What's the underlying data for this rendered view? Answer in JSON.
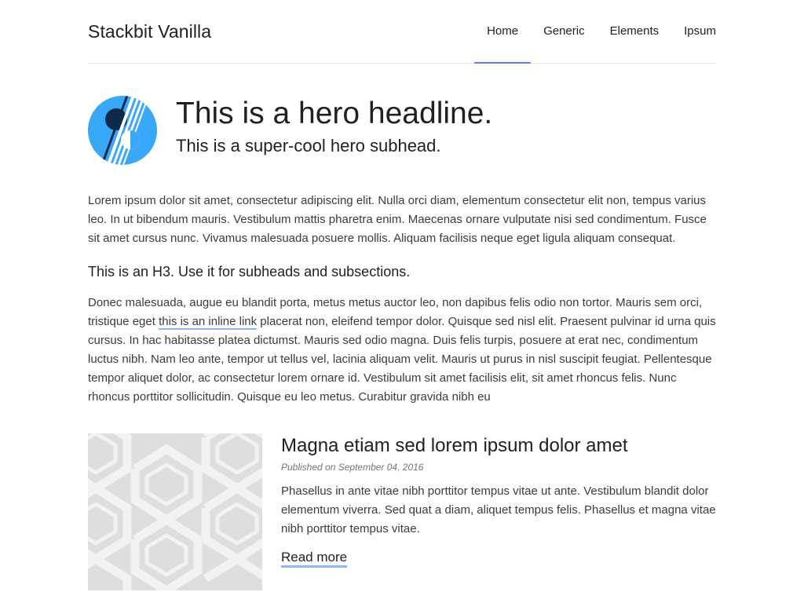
{
  "site": {
    "title": "Stackbit Vanilla"
  },
  "nav": {
    "items": [
      {
        "label": "Home",
        "active": true
      },
      {
        "label": "Generic",
        "active": false
      },
      {
        "label": "Elements",
        "active": false
      },
      {
        "label": "Ipsum",
        "active": false
      }
    ],
    "accent_color": "#4f87e6"
  },
  "hero": {
    "logo_icon": "stackbit-logo-icon",
    "title": "This is a hero headline.",
    "subhead": "This is a super-cool hero subhead."
  },
  "content": {
    "paragraph1": "Lorem ipsum dolor sit amet, consectetur adipiscing elit. Nulla orci diam, elementum consectetur elit non, tempus varius leo. In ut bibendum mauris. Vestibulum mattis pharetra enim. Maecenas ornare vulputate nisi sed condimentum. Fusce sit amet cursus nunc. Vivamus malesuada posuere mollis. Aliquam facilisis neque eget ligula aliquam consequat.",
    "h3": "This is an H3. Use it for subheads and subsections.",
    "paragraph2_before": "Donec malesuada, augue eu blandit porta, metus metus auctor leo, non dapibus felis odio non tortor. Mauris sem orci, tristique eget ",
    "paragraph2_link": "this is an inline link",
    "paragraph2_after": " placerat non, eleifend tempor dolor. Quisque sed nisl elit. Praesent pulvinar id urna quis cursus. In hac habitasse platea dictumst. Mauris sed odio magna. Duis felis turpis, posuere at erat nec, condimentum luctus nibh. Nam leo ante, tempor ut tellus vel, lacinia aliquam velit. Mauris ut purus in nisl suscipit feugiat. Pellentesque tempor aliquet dolor, ac consectetur lorem ornare id. Vestibulum sit amet facilisis elit, sit amet rhoncus felis. Nunc rhoncus porttitor sollicitudin. Quisque eu leo metus. Curabitur gravida nibh eu"
  },
  "post": {
    "title": "Magna etiam sed lorem ipsum dolor amet",
    "meta": "Published on September 04, 2016",
    "excerpt": "Phasellus in ante vitae nibh porttitor tempus vitae ut ante. Vestibulum blandit dolor elementum viverra. Sed quat a diam, aliquet tempus felis. Phasellus et magna vitae nibh porttitor tempus vitae.",
    "read_more": "Read more"
  }
}
